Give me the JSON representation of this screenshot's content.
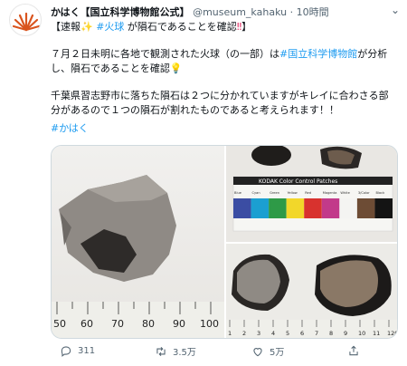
{
  "tweet": {
    "account_name": "かはく【国立科学博物館公式】",
    "handle": "@museum_kahaku",
    "separator": "·",
    "time": "10時間",
    "headline_prefix": "【速報",
    "headline_hashtag": "#火球",
    "headline_rest": "が隕石であることを確認",
    "headline_suffix": "】",
    "para1_a": "７月２日未明に各地で観測された火球（の一部）は",
    "para1_link": "#国立科学博物館",
    "para1_b": "が分析し、隕石であることを確認",
    "para2": "千葉県習志野市に落ちた隕石は２つに分かれていますがキレイに合わさる部分があるので１つの隕石が割れたものであると考えられます！！",
    "hashtag": "#かはく"
  },
  "media": {
    "ruler_numbers": [
      "50",
      "60",
      "70",
      "80",
      "90",
      "100"
    ],
    "ruler_numbers_small": [
      "1",
      "2",
      "3",
      "4",
      "5",
      "6",
      "7",
      "8",
      "9",
      "10",
      "11",
      "120"
    ],
    "patch_title": "KODAK Color Control Patches",
    "patch_labels": [
      "Blue",
      "Cyan",
      "Green",
      "Yellow",
      "Red",
      "Magenta",
      "White",
      "3/Color",
      "Black"
    ],
    "patch_colors": [
      "#3b4da3",
      "#1b9fd1",
      "#2e9a47",
      "#f2d72a",
      "#d8322e",
      "#c23a8a",
      "#f4f4f2",
      "#6d4c35",
      "#141414"
    ]
  },
  "actions": {
    "reply_count": "311",
    "retweet_count": "3.5万",
    "like_count": "",
    "share_count": "5万"
  },
  "colors": {
    "accent": "#1d9bf0",
    "muted": "#536471",
    "alert": "#e0245e"
  }
}
